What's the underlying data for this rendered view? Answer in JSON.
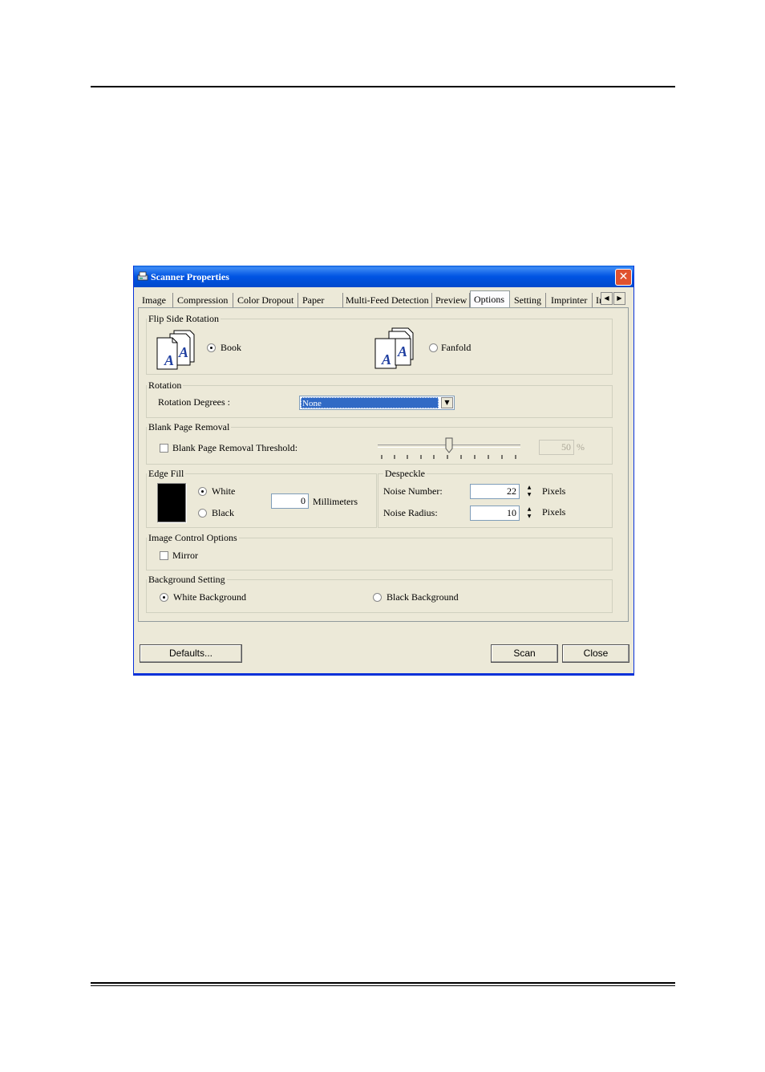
{
  "window": {
    "title": "Scanner Properties"
  },
  "tabs": [
    {
      "label": "Image",
      "active": false
    },
    {
      "label": "Compression",
      "active": false
    },
    {
      "label": "Color Dropout",
      "active": false
    },
    {
      "label": "Paper",
      "active": false
    },
    {
      "label": "Multi-Feed Detection",
      "active": false
    },
    {
      "label": "Preview",
      "active": false
    },
    {
      "label": "Options",
      "active": true
    },
    {
      "label": "Setting",
      "active": false
    },
    {
      "label": "Imprinter",
      "active": false
    },
    {
      "label": "Ir",
      "active": false
    }
  ],
  "flip_side": {
    "title": "Flip Side Rotation",
    "book_label": "Book",
    "fanfold_label": "Fanfold",
    "selected": "Book",
    "icon_letter": "A"
  },
  "rotation": {
    "title": "Rotation",
    "degrees_label": "Rotation Degrees :",
    "value": "None"
  },
  "blank_page": {
    "title": "Blank Page Removal",
    "checkbox_label": "Blank Page Removal Threshold:",
    "checked": false,
    "value": "50",
    "unit": "%",
    "slider_fraction": 0.5
  },
  "edge_fill": {
    "title": "Edge Fill",
    "white_label": "White",
    "black_label": "Black",
    "selected": "White",
    "value": "0",
    "unit": "Millimeters"
  },
  "despeckle": {
    "title": "Despeckle",
    "noise_number_label": "Noise Number:",
    "noise_number": "22",
    "noise_radius_label": "Noise Radius:",
    "noise_radius": "10",
    "unit": "Pixels"
  },
  "image_control": {
    "title": "Image Control Options",
    "mirror_label": "Mirror",
    "checked": false
  },
  "background": {
    "title": "Background Setting",
    "white_label": "White Background",
    "black_label": "Black Background",
    "selected": "White Background"
  },
  "buttons": {
    "defaults": "Defaults...",
    "scan": "Scan",
    "close": "Close"
  },
  "colors": {
    "title_bar": "#0054e3",
    "dialog_bg": "#ece9d8",
    "selection": "#316ac5"
  }
}
